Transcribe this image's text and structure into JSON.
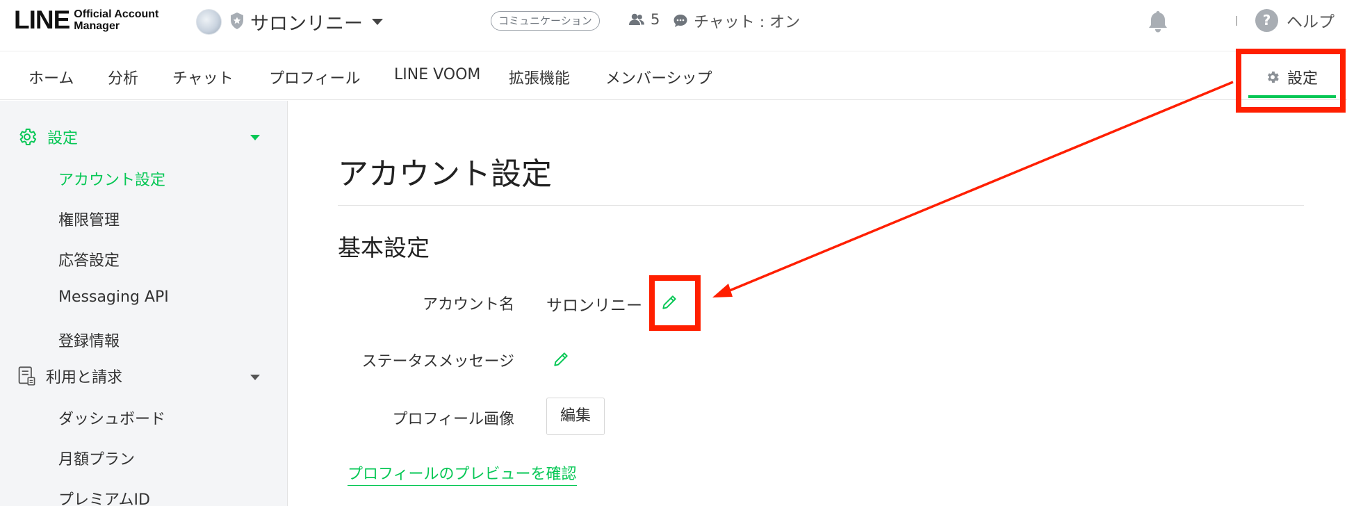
{
  "header": {
    "logo_main": "LINE",
    "logo_sub_line1": "Official Account",
    "logo_sub_line2": "Manager",
    "account_name": "サロンリニー",
    "mode_badge": "コミュニケーション",
    "friend_count": "5",
    "chat_status": "チャット : オン",
    "separator": "|",
    "help_label": "ヘルプ",
    "help_icon_glyph": "?"
  },
  "tabs": {
    "items": [
      "ホーム",
      "分析",
      "チャット",
      "プロフィール",
      "LINE VOOM",
      "拡張機能",
      "メンバーシップ"
    ],
    "settings_label": "設定"
  },
  "sidebar": {
    "settings_group": "設定",
    "settings_items": [
      "アカウント設定",
      "権限管理",
      "応答設定",
      "Messaging API",
      "登録情報"
    ],
    "billing_group": "利用と請求",
    "billing_items": [
      "ダッシュボード",
      "月額プラン",
      "プレミアムID"
    ]
  },
  "main": {
    "page_title": "アカウント設定",
    "section_title": "基本設定",
    "account_name_label": "アカウント名",
    "account_name_value": "サロンリニー",
    "status_message_label": "ステータスメッセージ",
    "profile_image_label": "プロフィール画像",
    "edit_button": "編集",
    "preview_link": "プロフィールのプレビューを確認"
  },
  "colors": {
    "accent_green": "#06c755",
    "annotation_red": "#ff1f00"
  }
}
